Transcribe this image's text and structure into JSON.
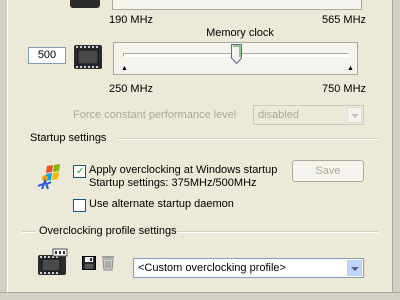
{
  "core_scale": {
    "min_label": "190 MHz",
    "max_label": "565 MHz"
  },
  "memory_clock": {
    "title": "Memory clock",
    "value": "500",
    "min_label": "250 MHz",
    "max_label": "750 MHz",
    "slider_min": 250,
    "slider_max": 750,
    "slider_value": 500
  },
  "performance": {
    "label": "Force constant performance level",
    "selected": "disabled"
  },
  "startup": {
    "group_title": "Startup settings",
    "apply_label": "Apply overclocking at Windows startup",
    "apply_checked": true,
    "startup_info": "Startup settings: 375MHz/500MHz",
    "save_label": "Save",
    "alternate_label": "Use alternate startup daemon",
    "alternate_checked": false
  },
  "profiles": {
    "group_title": "Overclocking profile settings",
    "selected": "<Custom overclocking profile>"
  },
  "colors": {
    "window_bg": "#ece9d8",
    "chip_dark": "#2b2b2b",
    "check_green": "#21a121",
    "disabled_text": "#aca899"
  },
  "icons": [
    "memory-chip-icon",
    "windows-logo-icon",
    "save-disk-icon",
    "trash-icon",
    "graphics-card-icon"
  ]
}
